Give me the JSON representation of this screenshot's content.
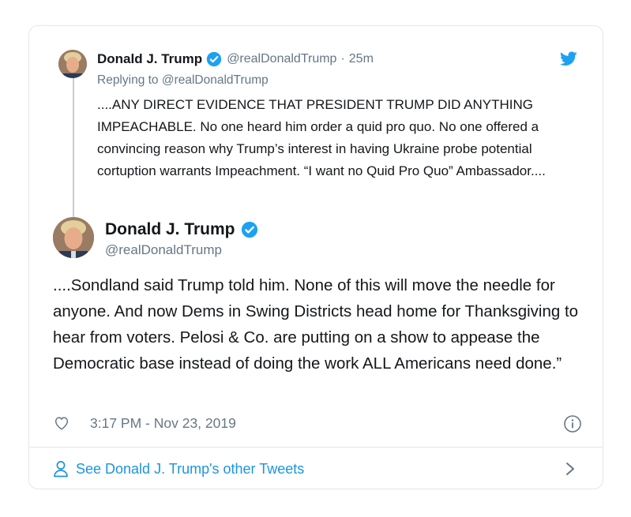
{
  "reply_tweet": {
    "name": "Donald J. Trump",
    "handle": "@realDonaldTrump",
    "separator": "·",
    "time_ago": "25m",
    "replying_to": "Replying to @realDonaldTrump",
    "text": "....ANY DIRECT EVIDENCE THAT PRESIDENT TRUMP DID ANYTHING IMPEACHABLE. No one heard him order a quid pro quo. No one offered a convincing reason why Trump’s interest in having Ukraine probe potential cortuption warrants Impeachment. “I want no Quid Pro Quo” Ambassador...."
  },
  "main_tweet": {
    "name": "Donald J. Trump",
    "handle": "@realDonaldTrump",
    "text": "....Sondland said Trump told him. None of this will move the needle for anyone. And now Dems in Swing Districts head home for Thanksgiving to hear from voters. Pelosi & Co. are putting on a show to appease the Democratic base instead of doing the work ALL Americans need done.”",
    "timestamp": "3:17 PM - Nov 23, 2019"
  },
  "footer": {
    "link_label": "See Donald J. Trump's other Tweets"
  },
  "icons": {
    "verified": "verified-badge-icon",
    "twitter": "twitter-bird-icon",
    "like": "heart-icon",
    "info": "info-icon",
    "profile": "person-icon",
    "chevron": "chevron-right-icon"
  },
  "colors": {
    "accent": "#1b95e0",
    "verified": "#1da1f2",
    "secondary_text": "#657786",
    "border": "#e1e8ed"
  }
}
